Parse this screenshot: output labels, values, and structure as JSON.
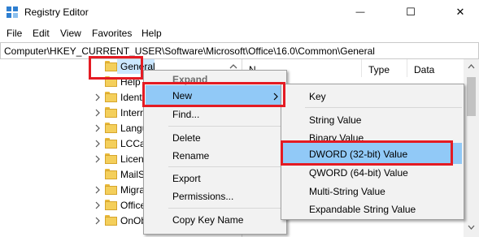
{
  "window": {
    "title": "Registry Editor",
    "minimize_glyph": "—",
    "maximize_glyph": "☐",
    "close_glyph": "✕"
  },
  "menubar": [
    "File",
    "Edit",
    "View",
    "Favorites",
    "Help"
  ],
  "address": "Computer\\HKEY_CURRENT_USER\\Software\\Microsoft\\Office\\16.0\\Common\\General",
  "tree": {
    "items": [
      "General",
      "Help",
      "Ident",
      "Interr",
      "Langu",
      "LCCa",
      "Licen",
      "MailS",
      "Migra",
      "Office",
      "OnOb"
    ]
  },
  "right_pane": {
    "columns": [
      "N",
      "Type",
      "Data"
    ],
    "fragments": [
      "s",
      "or",
      "2",
      "01",
      "01"
    ]
  },
  "context_menu": {
    "items": [
      "Expand",
      "New",
      "Find...",
      "Delete",
      "Rename",
      "Export",
      "Permissions...",
      "Copy Key Name"
    ],
    "highlighted": "New"
  },
  "submenu": {
    "items": [
      "Key",
      "String Value",
      "Binary Value",
      "DWORD (32-bit) Value",
      "QWORD (64-bit) Value",
      "Multi-String Value",
      "Expandable String Value"
    ],
    "highlighted": "DWORD (32-bit) Value"
  },
  "colors": {
    "highlight": "#91c9f7",
    "selection": "#cce8ff",
    "annotation_red": "#e41b23",
    "folder_yellow": "#f4cf5b"
  },
  "icons": {
    "app": "registry-editor-icon",
    "tree_expand": "chevron-right-icon",
    "folder": "folder-icon",
    "submenu": "chevron-right-icon"
  }
}
